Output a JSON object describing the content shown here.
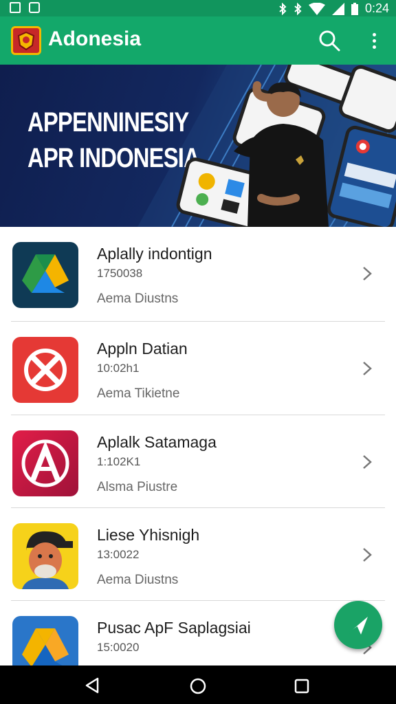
{
  "status_bar": {
    "time": "0:24",
    "icons": [
      "gallery-icon",
      "camera-icon",
      "bluetooth-icon",
      "bluetooth-icon",
      "wifi-icon",
      "no-sim-icon",
      "battery-icon"
    ]
  },
  "app_bar": {
    "title": "Adonesia",
    "logo_icon": "crest-logo-icon",
    "actions": [
      "search-icon",
      "more-vert-icon"
    ],
    "color": "#13a86a"
  },
  "banner": {
    "line1": "APPENNINESIY",
    "line2": "APR INDONESIA"
  },
  "apps": [
    {
      "title": "Aplally indontign",
      "number": "1750038",
      "subtitle": "Aema Diustns",
      "icon": "drive-triangle-icon"
    },
    {
      "title": "Appln Datian",
      "number": "10:02h1",
      "subtitle": "Aema Tikietne",
      "icon": "red-cross-circle-icon"
    },
    {
      "title": "Aplalk Satamaga",
      "number": "1:102K1",
      "subtitle": "Alsma Piustre",
      "icon": "red-a-logo-icon"
    },
    {
      "title": "Liese Yhisnigh",
      "number": "13:0022",
      "subtitle": "Aema Diustns",
      "icon": "cartoon-man-icon"
    },
    {
      "title": "Pusac ApF Saplagsiai",
      "number": "15:0020",
      "subtitle": "",
      "icon": "drive-triangle-icon"
    }
  ],
  "fab": {
    "icon": "send-plane-icon"
  },
  "nav_bar": {
    "buttons": [
      "back-icon",
      "home-icon",
      "recents-icon"
    ]
  }
}
